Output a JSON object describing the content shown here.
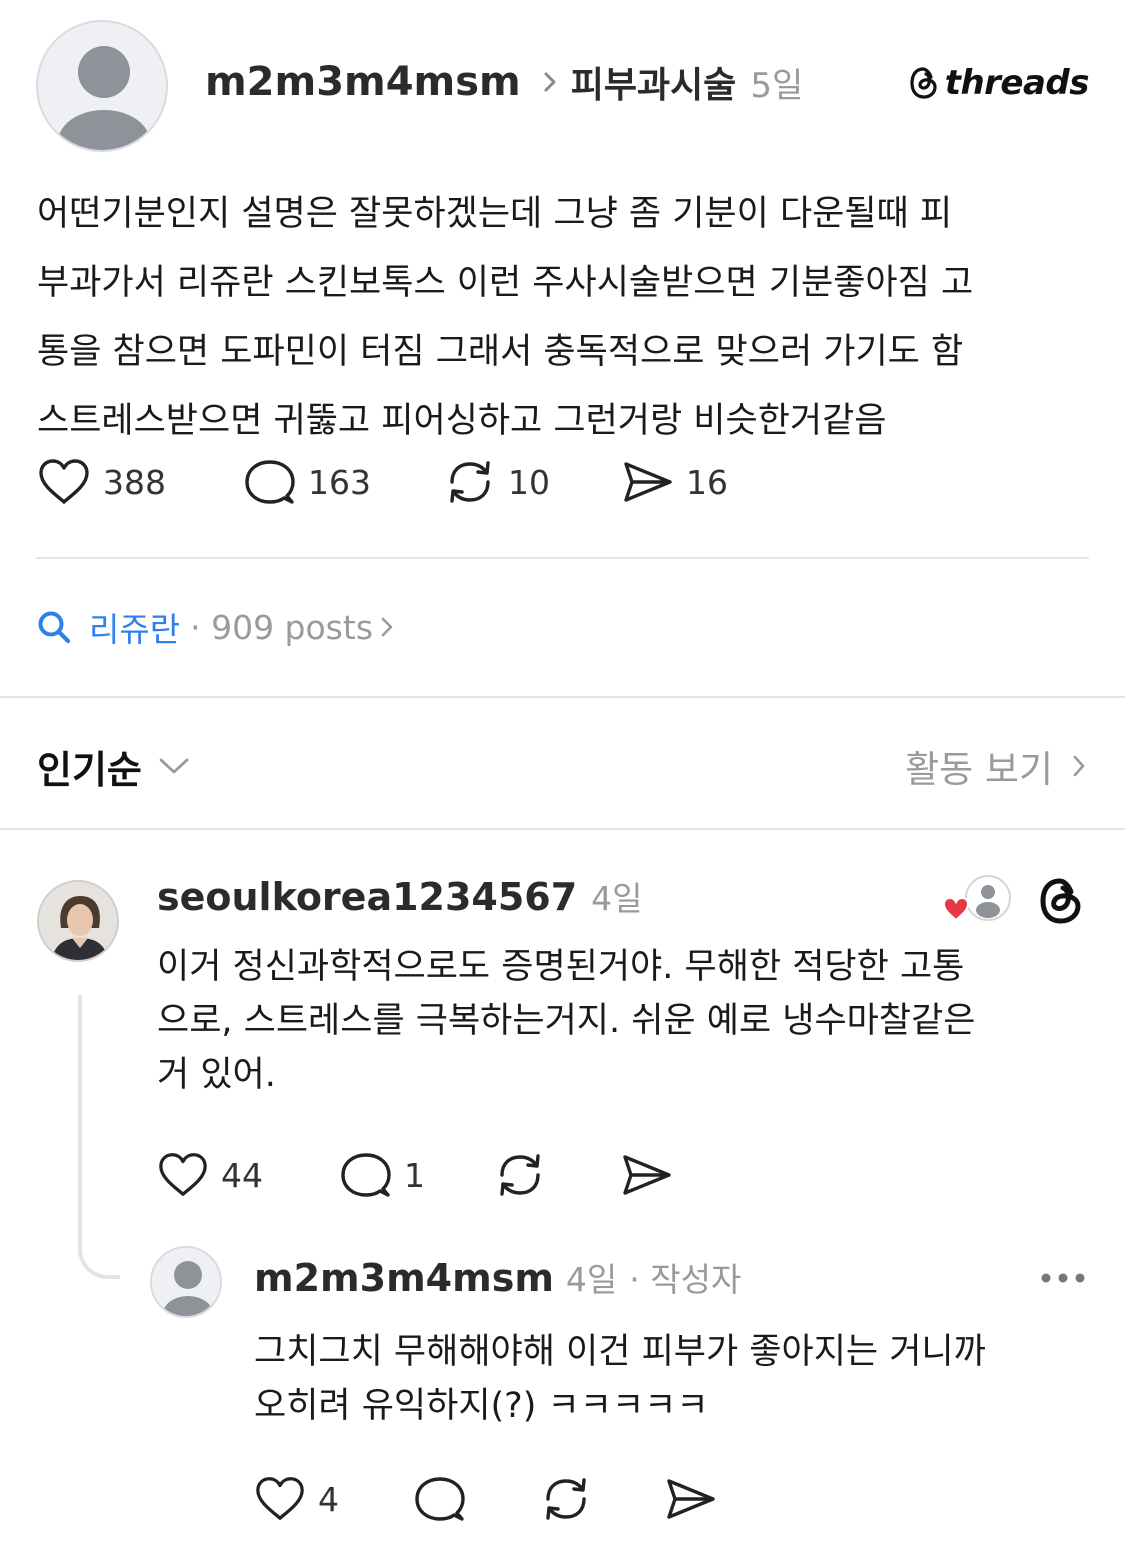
{
  "post": {
    "author": "m2m3m4msm",
    "topic": "피부과시술",
    "time": "5일",
    "brand": "threads",
    "body_lines": [
      "어떤기분인지 설명은 잘못하겠는데 그냥 좀 기분이 다운될때 피",
      "부과가서 리쥬란 스킨보톡스 이런 주사시술받으면 기분좋아짐 고",
      "통을 참으면 도파민이 터짐 그래서 충독적으로 맞으러 가기도 함",
      "스트레스받으면 귀뚫고 피어싱하고 그런거랑 비슷한거같음"
    ],
    "likes": "388",
    "comments": "163",
    "reposts": "10",
    "shares": "16"
  },
  "tag": {
    "name": "리쥬란",
    "meta": "· 909 posts"
  },
  "sort": {
    "label": "인기순",
    "activity": "활동 보기"
  },
  "replies": [
    {
      "user": "seoulkorea1234567",
      "time": "4일",
      "lines": [
        "이거 정신과학적으로도 증명된거야. 무해한 적당한 고통",
        "으로, 스트레스를 극복하는거지. 쉬운 예로 냉수마찰같은",
        "거 있어."
      ],
      "likes": "44",
      "comments": "1"
    },
    {
      "user": "m2m3m4msm",
      "time": "4일",
      "meta": "· 작성자",
      "lines": [
        "그치그치 무해해야해 이건 피부가 좋아지는 거니까",
        "오히려 유익하지(?) ㅋㅋㅋㅋㅋ"
      ],
      "likes": "4"
    }
  ],
  "colors": {
    "accent_blue": "#2f80ed",
    "heart_red": "#e53945",
    "muted_gray": "#9a9a9a"
  },
  "icons": [
    "avatar-placeholder-icon",
    "chevron-right-icon",
    "threads-logo-icon",
    "heart-icon",
    "comment-icon",
    "repost-icon",
    "share-icon",
    "search-icon",
    "chevron-down-icon",
    "more-icon",
    "liked-by-author-icon"
  ]
}
